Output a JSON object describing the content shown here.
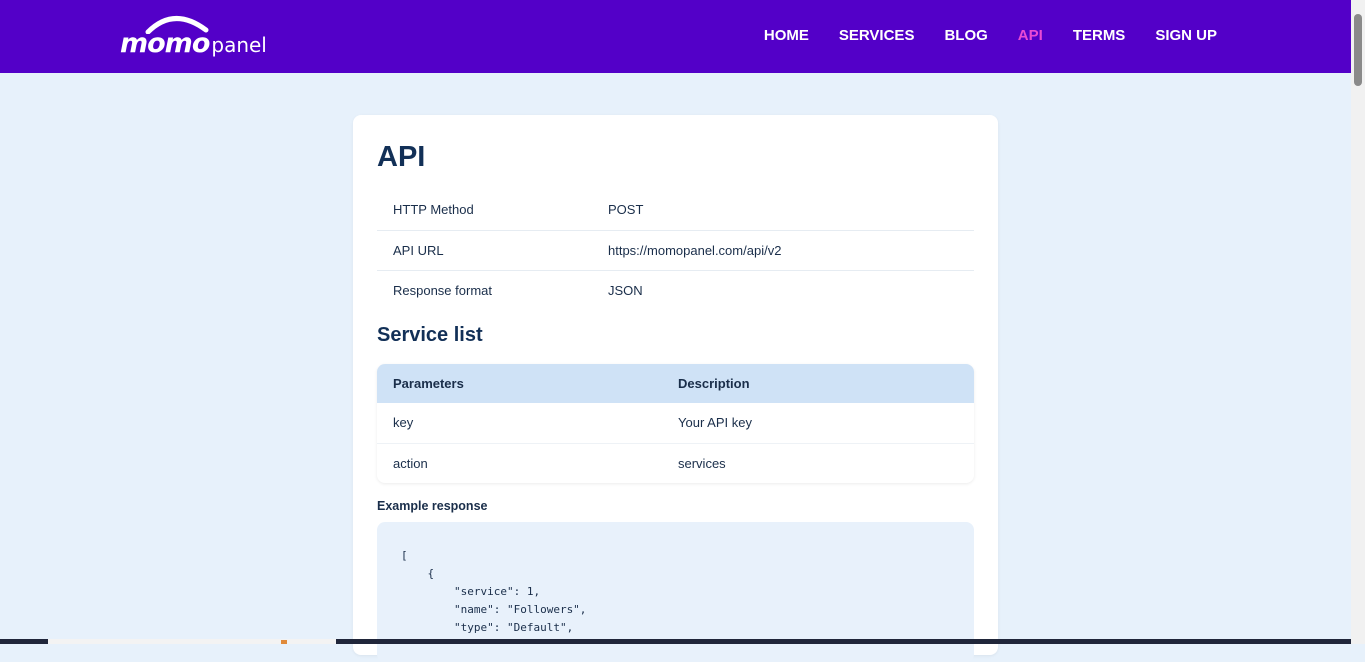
{
  "brand": {
    "logo_text_1": "momo",
    "logo_text_2": "panel"
  },
  "nav": {
    "items": [
      {
        "label": "HOME",
        "active": false
      },
      {
        "label": "SERVICES",
        "active": false
      },
      {
        "label": "BLOG",
        "active": false
      },
      {
        "label": "API",
        "active": true
      },
      {
        "label": "TERMS",
        "active": false
      },
      {
        "label": "SIGN UP",
        "active": false
      }
    ],
    "active_color": "#e94bd4",
    "bar_color": "#5300c8"
  },
  "page": {
    "title": "API",
    "info_rows": [
      {
        "key": "HTTP Method",
        "value": "POST"
      },
      {
        "key": "API URL",
        "value": "https://momopanel.com/api/v2"
      },
      {
        "key": "Response format",
        "value": "JSON"
      }
    ],
    "section_title": "Service list",
    "params_headers": {
      "param": "Parameters",
      "desc": "Description"
    },
    "params_rows": [
      {
        "param": "key",
        "desc": "Your API key"
      },
      {
        "param": "action",
        "desc": "services"
      }
    ],
    "example_label": "Example response",
    "example_code": "[\n    {\n        \"service\": 1,\n        \"name\": \"Followers\",\n        \"type\": \"Default\","
  }
}
